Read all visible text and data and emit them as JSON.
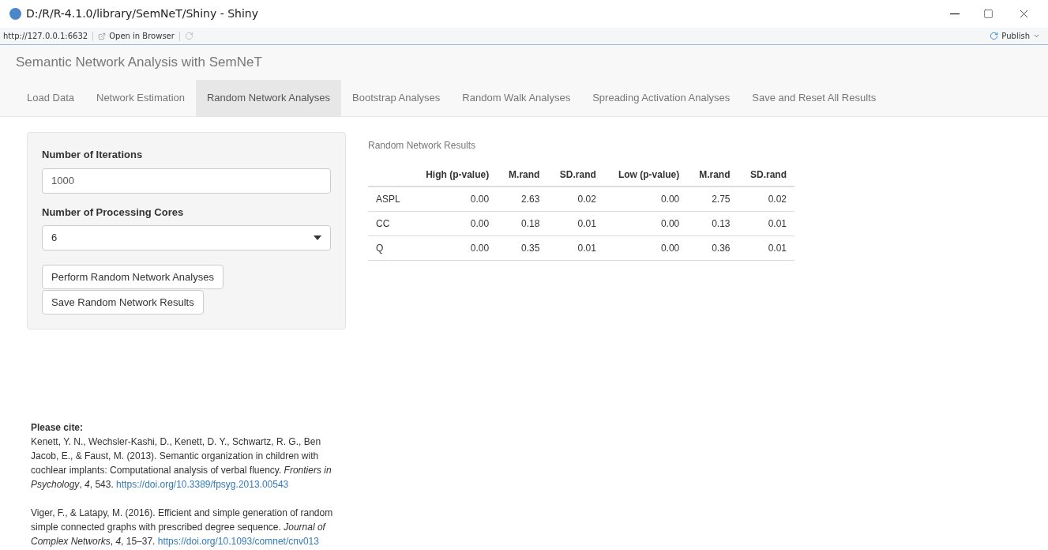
{
  "window": {
    "title": "D:/R/R-4.1.0/library/SemNeT/Shiny - Shiny"
  },
  "toolbar": {
    "url": "http://127.0.0.1:6632",
    "open_in_browser": "Open in Browser",
    "publish": "Publish"
  },
  "app": {
    "title": "Semantic Network Analysis with SemNeT"
  },
  "tabs": [
    {
      "label": "Load Data",
      "selected": false
    },
    {
      "label": "Network Estimation",
      "selected": false
    },
    {
      "label": "Random Network Analyses",
      "selected": true
    },
    {
      "label": "Bootstrap Analyses",
      "selected": false
    },
    {
      "label": "Random Walk Analyses",
      "selected": false
    },
    {
      "label": "Spreading Activation Analyses",
      "selected": false
    },
    {
      "label": "Save and Reset All Results",
      "selected": false
    }
  ],
  "sidebar": {
    "iterations": {
      "label": "Number of Iterations",
      "value": "1000"
    },
    "cores": {
      "label": "Number of Processing Cores",
      "value": "6"
    },
    "buttons": [
      "Perform Random Network Analyses",
      "Save Random Network Results"
    ]
  },
  "results": {
    "caption": "Random Network Results",
    "columns": [
      "",
      "High (p-value)",
      "M.rand",
      "SD.rand",
      "Low (p-value)",
      "M.rand",
      "SD.rand"
    ],
    "rows": [
      [
        "ASPL",
        "0.00",
        "2.63",
        "0.02",
        "0.00",
        "2.75",
        "0.02"
      ],
      [
        "CC",
        "0.00",
        "0.18",
        "0.01",
        "0.00",
        "0.13",
        "0.01"
      ],
      [
        "Q",
        "0.00",
        "0.35",
        "0.01",
        "0.00",
        "0.36",
        "0.01"
      ]
    ]
  },
  "citations": {
    "heading": "Please cite:",
    "items": [
      {
        "text": "Kenett, Y. N., Wechsler-Kashi, D., Kenett, D. Y., Schwartz, R. G., Ben Jacob, E., & Faust, M. (2013). Semantic organization in children with cochlear implants: Computational analysis of verbal fluency. *Frontiers in Psychology*, *4*, 543.",
        "link": "https://doi.org/10.3389/fpsyg.2013.00543"
      },
      {
        "text": "Viger, F., & Latapy, M. (2016). Efficient and simple generation of random simple connected graphs with prescribed degree sequence. *Journal of Complex Networks*, *4*, 15–37.",
        "link": "https://doi.org/10.1093/comnet/cnv013"
      }
    ]
  }
}
